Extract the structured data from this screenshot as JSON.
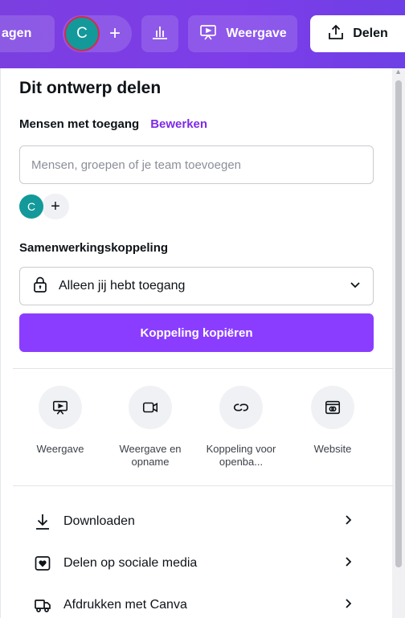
{
  "topbar": {
    "left_button_label": "agen",
    "avatar_initial": "C",
    "add_label": "+",
    "present_label": "Weergave",
    "share_label": "Delen"
  },
  "panel": {
    "title": "Dit ontwerp delen",
    "people_access_label": "Mensen met toegang",
    "edit_label": "Bewerken",
    "people_input_placeholder": "Mensen, groepen of je team toevoegen",
    "member_initial": "C",
    "add_member_label": "+",
    "collab_link_label": "Samenwerkingskoppeling",
    "access_value": "Alleen jij hebt toegang",
    "copy_link_label": "Koppeling kopiëren"
  },
  "share_options": [
    {
      "label": "Weergave",
      "icon": "present-icon"
    },
    {
      "label": "Weergave en opname",
      "icon": "video-camera-icon"
    },
    {
      "label": "Koppeling voor openba...",
      "icon": "link-icon"
    },
    {
      "label": "Website",
      "icon": "website-icon"
    }
  ],
  "menu": [
    {
      "label": "Downloaden",
      "icon": "download-icon"
    },
    {
      "label": "Delen op sociale media",
      "icon": "heart-social-icon"
    },
    {
      "label": "Afdrukken met Canva",
      "icon": "truck-icon"
    }
  ],
  "colors": {
    "brand_purple": "#8b3dff",
    "avatar_teal": "#13999a"
  }
}
